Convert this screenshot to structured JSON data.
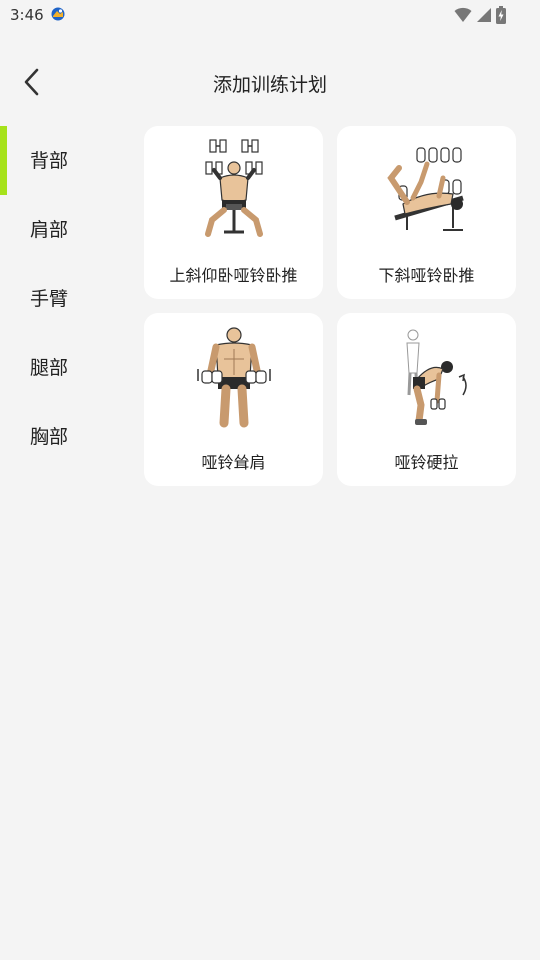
{
  "status_bar": {
    "time": "3:46",
    "icons": [
      "app-notification-icon",
      "wifi-icon",
      "signal-icon",
      "battery-charging-icon"
    ]
  },
  "header": {
    "title": "添加训练计划",
    "back_icon": "chevron-left-icon"
  },
  "sidebar": {
    "accent_color": "#a6e21b",
    "selected_index": 0,
    "items": [
      {
        "label": "背部"
      },
      {
        "label": "肩部"
      },
      {
        "label": "手臂"
      },
      {
        "label": "腿部"
      },
      {
        "label": "胸部"
      }
    ]
  },
  "exercises": [
    {
      "label": "上斜仰卧哑铃卧推",
      "icon": "incline-dumbbell-press-illustration"
    },
    {
      "label": "下斜哑铃卧推",
      "icon": "decline-dumbbell-press-illustration"
    },
    {
      "label": "哑铃耸肩",
      "icon": "dumbbell-shrug-illustration"
    },
    {
      "label": "哑铃硬拉",
      "icon": "dumbbell-deadlift-illustration"
    }
  ]
}
